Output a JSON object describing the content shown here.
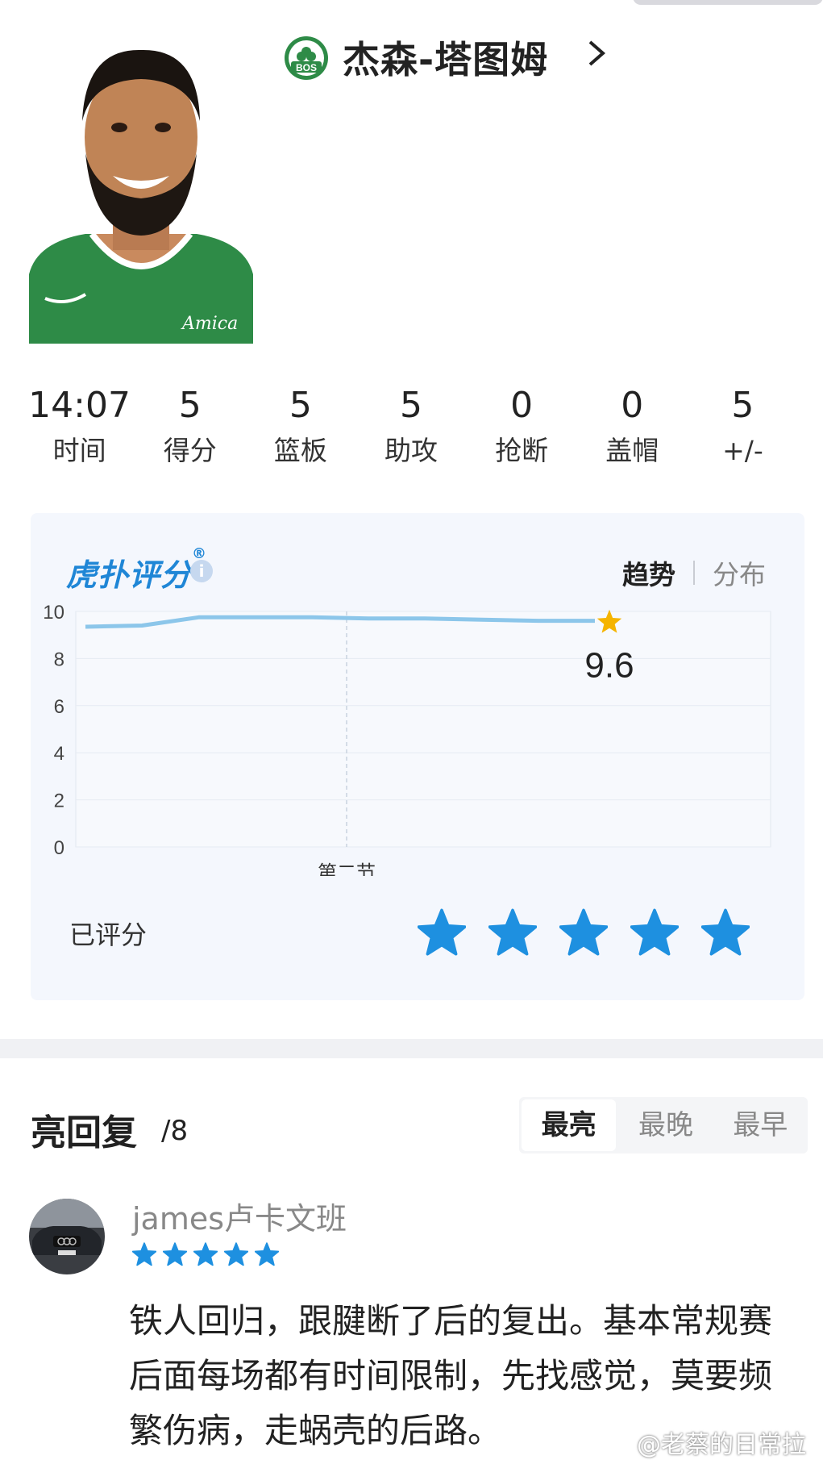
{
  "header": {
    "team_abbr": "BOS",
    "player_name": "杰森-塔图姆",
    "jersey_sponsor": "Amica",
    "team_color": "#2e8b47"
  },
  "stats": [
    {
      "value": "14:07",
      "label": "时间"
    },
    {
      "value": "5",
      "label": "得分"
    },
    {
      "value": "5",
      "label": "篮板"
    },
    {
      "value": "5",
      "label": "助攻"
    },
    {
      "value": "0",
      "label": "抢断"
    },
    {
      "value": "0",
      "label": "盖帽"
    },
    {
      "value": "5",
      "label": "+/-"
    }
  ],
  "rating": {
    "brand": "虎扑评分",
    "brand_mark": "®",
    "info_icon": "i",
    "tabs": {
      "active": "趋势",
      "other": "分布"
    },
    "current_score": "9.6",
    "rated_label": "已评分",
    "user_stars": 5,
    "accent": "#1e90e0"
  },
  "chart_data": {
    "type": "line",
    "ylim": [
      0,
      10
    ],
    "yticks": [
      "10",
      "8",
      "6",
      "4",
      "2",
      "0"
    ],
    "x_marker_label": "第二节",
    "series": [
      {
        "values": [
          9.35,
          9.4,
          9.75,
          9.75,
          9.75,
          9.7,
          9.7,
          9.65,
          9.6,
          9.6
        ]
      }
    ],
    "highlight": {
      "value": 9.6,
      "label": "9.6"
    },
    "line_color": "#8cc6ea",
    "star_color": "#f5b400"
  },
  "replies": {
    "title": "亮回复",
    "count": "/8",
    "sort_options": [
      "最亮",
      "最晚",
      "最早"
    ],
    "active_sort": "最亮",
    "comments": [
      {
        "user": "james卢卡文班",
        "stars": 5,
        "text": "铁人回归，跟腱断了后的复出。基本常规赛后面每场都有时间限制，先找感觉，莫要频繁伤病，走蜗壳的后路。"
      }
    ]
  },
  "watermark": "@老蔡的日常拉"
}
